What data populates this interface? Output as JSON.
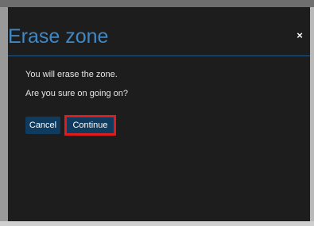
{
  "dialog": {
    "title": "Erase zone",
    "close_label": "×",
    "message_line_1": "You will erase the zone.",
    "message_line_2": "Are you sure on going on?",
    "cancel_label": "Cancel",
    "continue_label": "Continue"
  },
  "colors": {
    "title": "#3f88c5",
    "dialog_background": "#1d1d1d",
    "button_background": "#0f3b5f",
    "focus_highlight": "#e01b1b",
    "header_rule": "#2a5b86"
  },
  "icons": {
    "close": "close-icon"
  }
}
